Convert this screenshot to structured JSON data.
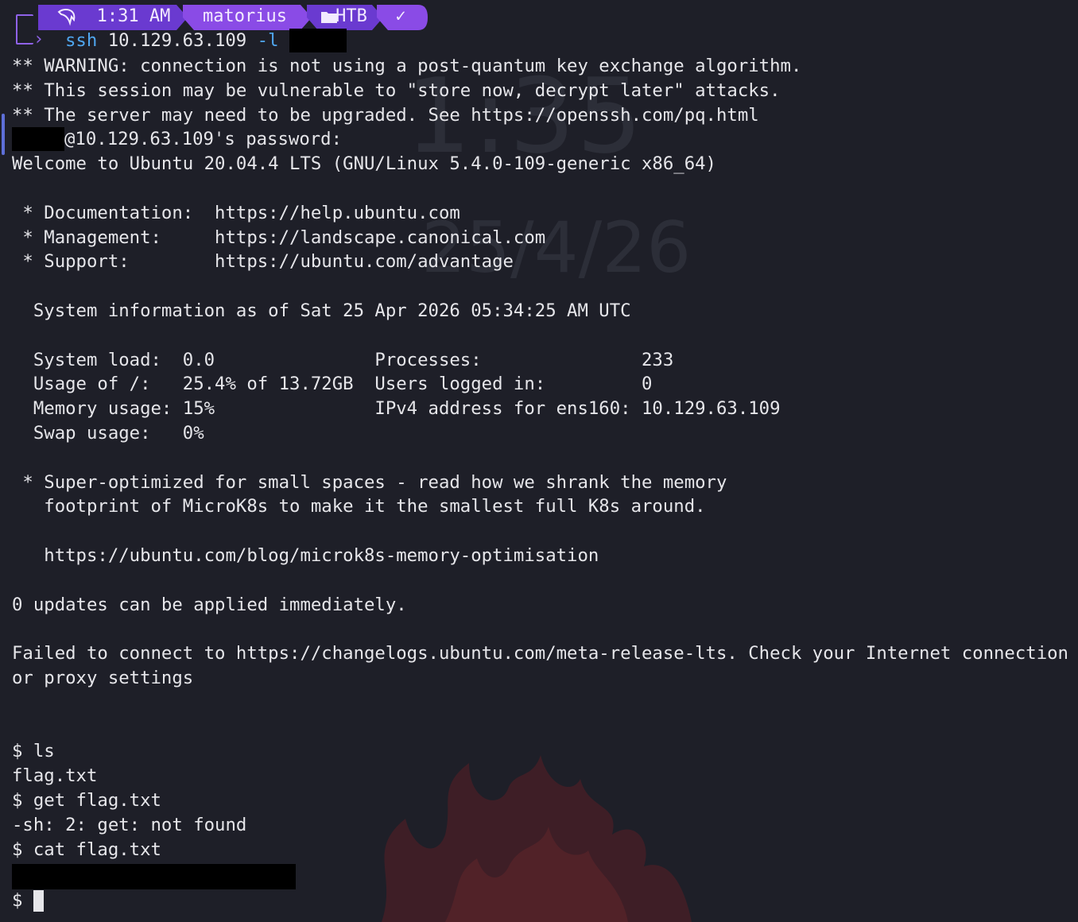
{
  "prompt": {
    "time": "1:31 AM",
    "user": "matorius",
    "dir": "HTB",
    "status": "✓",
    "logo_icon": "dragon-icon",
    "folder_icon": "folder-icon",
    "accent_color": "#8f62e8"
  },
  "command": {
    "program": "ssh",
    "args": " 10.129.63.109 ",
    "flag": "-l"
  },
  "output_lines": [
    "** WARNING: connection is not using a post-quantum key exchange algorithm.",
    "** This session may be vulnerable to \"store now, decrypt later\" attacks.",
    "** The server may need to be upgraded. See https://openssh.com/pq.html",
    "@10.129.63.109's password:",
    "Welcome to Ubuntu 20.04.4 LTS (GNU/Linux 5.4.0-109-generic x86_64)",
    "",
    " * Documentation:  https://help.ubuntu.com",
    " * Management:     https://landscape.canonical.com",
    " * Support:        https://ubuntu.com/advantage",
    "",
    "  System information as of Sat 25 Apr 2026 05:34:25 AM UTC",
    "",
    "  System load:  0.0               Processes:               233",
    "  Usage of /:   25.4% of 13.72GB  Users logged in:         0",
    "  Memory usage: 15%               IPv4 address for ens160: 10.129.63.109",
    "  Swap usage:   0%",
    "",
    " * Super-optimized for small spaces - read how we shrank the memory",
    "   footprint of MicroK8s to make it the smallest full K8s around.",
    "",
    "   https://ubuntu.com/blog/microk8s-memory-optimisation",
    "",
    "0 updates can be applied immediately.",
    "",
    "Failed to connect to https://changelogs.ubuntu.com/meta-release-lts. Check your Internet connection",
    "or proxy settings",
    "",
    "",
    "$ ls",
    "flag.txt",
    "$ get flag.txt",
    "-sh: 2: get: not found",
    "$ cat flag.txt",
    "",
    "$ "
  ],
  "wallpaper": {
    "time": "1:35",
    "date": "25/4/26"
  },
  "colors": {
    "background": "#1e1f28",
    "foreground": "#e6e6ea",
    "command_blue": "#4fa6ef",
    "powerline_purple": "#7d3fd6",
    "powerline_violet": "#9b59e8"
  }
}
